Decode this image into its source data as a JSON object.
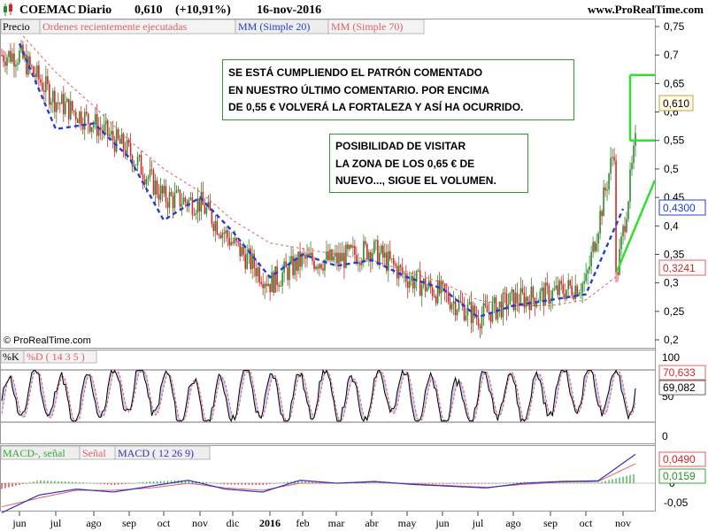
{
  "header": {
    "ticker": "COEMAC",
    "period": "Diario",
    "price": "0,610",
    "change": "(+10,91%)",
    "date": "16-nov-2016",
    "site": "www.ProRealTime.com"
  },
  "legend": {
    "price": "Precio",
    "orders": "Ordenes recientemente ejecutadas",
    "ma20": "MM (Simple 20)",
    "ma70": "MM (Simple 70)"
  },
  "copyright": "© ProRealTime.com",
  "notes": {
    "note1": [
      "SE ESTÁ CUMPLIENDO EL PATRÓN COMENTADO",
      "EN NUESTRO ÚLTIMO COMENTARIO. POR ENCIMA",
      "DE 0,55 € VOLVERÁ LA FORTALEZA Y ASÍ HA OCURRIDO."
    ],
    "note2": [
      "POSIBILIDAD DE VISITAR",
      "LA ZONA DE LOS 0,65 € DE",
      "NUEVO..., SIGUE EL VOLUMEN."
    ]
  },
  "x_axis": {
    "labels": [
      "jun",
      "jul",
      "ago",
      "sep",
      "oct",
      "nov",
      "dic",
      "2016",
      "feb",
      "mar",
      "abr",
      "may",
      "jun",
      "jul",
      "ago",
      "sep",
      "oct",
      "nov"
    ]
  },
  "price_axis": {
    "ticks": [
      "0,75",
      "0,7",
      "0,65",
      "0,6",
      "0,55",
      "0,5",
      "0,45",
      "0,4",
      "0,35",
      "0,3",
      "0,25",
      "0,2"
    ],
    "badges": {
      "last": "0,610",
      "ma20": "0,4300",
      "ma70": "0,3241"
    }
  },
  "stoch_axis": {
    "legend_k": "%K",
    "legend_d": "%D ( 14 3 5 )",
    "ticks": [
      "100",
      "50",
      "0"
    ],
    "badges": {
      "k": "70,633",
      "d": "69,082"
    }
  },
  "macd_axis": {
    "legend_hist": "MACD-, señal",
    "legend_signal": "Señal",
    "legend_macd": "MACD ( 12 26 9)",
    "ticks": [
      "0",
      "-0,05"
    ],
    "badges": {
      "macd": "0,0490",
      "hist": "0,0159"
    }
  },
  "colors": {
    "up": "#2e8b2e",
    "down": "#d22828",
    "ma20": "#1f3fd0",
    "ma70": "#e06060",
    "stoch_k": "#000000",
    "stoch_d": "#e06060",
    "stoch_fill": "#aaaaee",
    "macd": "#3030c0",
    "signal": "#e06060",
    "hist": "#33aa33",
    "annotation": "#33dd33",
    "note_border": "#2a9a2a"
  },
  "chart_data": [
    {
      "type": "candlestick",
      "title": "COEMAC Diario",
      "ylim": [
        0.19,
        0.76
      ],
      "x": [
        "2015-06",
        "2015-07",
        "2015-08",
        "2015-09",
        "2015-10",
        "2015-11",
        "2015-12",
        "2016-01",
        "2016-02",
        "2016-03",
        "2016-04",
        "2016-05",
        "2016-06",
        "2016-07",
        "2016-08",
        "2016-09",
        "2016-10",
        "2016-11"
      ],
      "series": [
        {
          "name": "Precio",
          "values": [
            0.7,
            0.62,
            0.58,
            0.53,
            0.45,
            0.44,
            0.37,
            0.3,
            0.34,
            0.34,
            0.36,
            0.31,
            0.28,
            0.24,
            0.27,
            0.28,
            0.3,
            0.61
          ]
        },
        {
          "name": "MM (Simple 20)",
          "values": [
            0.72,
            0.57,
            0.58,
            0.52,
            0.41,
            0.45,
            0.39,
            0.31,
            0.35,
            0.33,
            0.34,
            0.31,
            0.29,
            0.24,
            0.26,
            0.27,
            0.28,
            0.43
          ]
        },
        {
          "name": "MM (Simple 70)",
          "values": [
            0.74,
            0.67,
            0.61,
            0.55,
            0.5,
            0.46,
            0.41,
            0.37,
            0.36,
            0.35,
            0.34,
            0.32,
            0.3,
            0.27,
            0.26,
            0.26,
            0.27,
            0.32
          ]
        }
      ],
      "annotations": {
        "resistance_levels": [
          0.665,
          0.55
        ],
        "last": 0.61,
        "last_change_pct": 10.91
      }
    },
    {
      "type": "line",
      "title": "%K / %D ( 14 3 5 )",
      "ylim": [
        0,
        100
      ],
      "series": [
        {
          "name": "%K",
          "values": [
            20,
            82,
            15,
            70,
            95,
            30,
            10,
            80,
            25,
            75,
            20,
            85,
            30,
            10,
            70,
            30,
            90,
            75,
            71
          ]
        },
        {
          "name": "%D",
          "values": [
            25,
            75,
            20,
            65,
            85,
            35,
            15,
            75,
            30,
            70,
            25,
            80,
            35,
            15,
            65,
            35,
            80,
            72,
            69
          ]
        }
      ],
      "last": {
        "k": 70.633,
        "d": 69.082
      }
    },
    {
      "type": "bar",
      "title": "MACD ( 12 26 9)",
      "ylim": [
        -0.07,
        0.06
      ],
      "series": [
        {
          "name": "MACD",
          "values": [
            -0.05,
            -0.02,
            -0.01,
            -0.015,
            -0.005,
            0.005,
            -0.01,
            -0.015,
            0.005,
            0.0,
            0.003,
            -0.002,
            -0.005,
            -0.008,
            0.0,
            0.003,
            0.004,
            0.049
          ]
        },
        {
          "name": "Señal",
          "values": [
            -0.04,
            -0.025,
            -0.012,
            -0.012,
            -0.008,
            0.0,
            -0.008,
            -0.012,
            0.0,
            0.0,
            0.002,
            -0.001,
            -0.004,
            -0.007,
            -0.002,
            0.002,
            0.003,
            0.033
          ]
        },
        {
          "name": "MACD-, señal",
          "values": [
            -0.01,
            0.005,
            0.002,
            -0.003,
            0.003,
            0.005,
            -0.002,
            -0.003,
            0.005,
            0.0,
            0.001,
            -0.001,
            -0.001,
            -0.001,
            0.002,
            0.001,
            0.001,
            0.0159
          ]
        }
      ],
      "last": {
        "macd": 0.049,
        "hist": 0.0159
      }
    }
  ]
}
